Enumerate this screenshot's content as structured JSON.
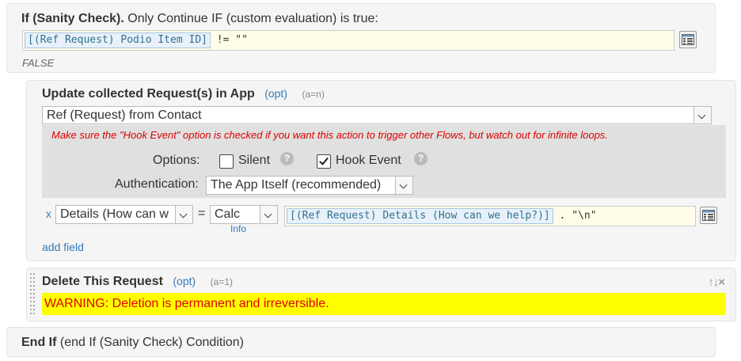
{
  "if_block": {
    "keyword": "If (Sanity Check).",
    "description": "Only Continue IF (custom evaluation) is true:",
    "condition_token": "[(Ref Request) Podio Item ID]",
    "condition_rest": " != \"\"",
    "result": "FALSE"
  },
  "update_block": {
    "title": "Update collected Request(s) in App",
    "opt": "(opt)",
    "an": "(a=n)",
    "target_select": "Ref (Request) from Contact",
    "hook_warning": "Make sure the \"Hook Event\" option is checked if you want this action to trigger other Flows, but watch out for infinite loops.",
    "options_label": "Options:",
    "silent_label": "Silent",
    "silent_checked": false,
    "hook_label": "Hook Event",
    "hook_checked": true,
    "help_glyph": "?",
    "auth_label": "Authentication:",
    "auth_value": "The App Itself (recommended)",
    "field": {
      "remove": "x",
      "name": "Details (How can w",
      "equals": "=",
      "mode": "Calc",
      "info": "Info",
      "value_token": "[(Ref Request) Details (How can we help?)]",
      "value_rest": " . \"\\n\""
    },
    "add_field": "add field"
  },
  "delete_block": {
    "title": "Delete This Request",
    "opt": "(opt)",
    "an": "(a=1)",
    "controls": "↑↓×",
    "warning": "WARNING: Deletion is permanent and irreversible."
  },
  "endif_block": {
    "keyword": "End If",
    "description": "(end If (Sanity Check) Condition)"
  },
  "colors": {
    "link": "#337ab7",
    "warning_text": "#dd0000",
    "warning_bg": "#ffff00",
    "expression_bg": "#fffde8"
  },
  "icons": [
    "expression-editor-icon",
    "chevron-down-icon",
    "help-icon",
    "drag-handle-icon",
    "move-up-icon",
    "move-down-icon",
    "close-icon"
  ]
}
